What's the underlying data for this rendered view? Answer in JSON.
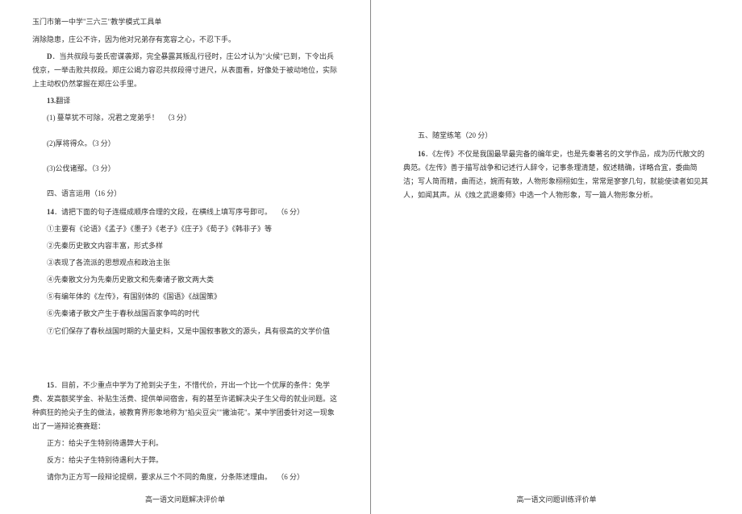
{
  "header": {
    "school_title": "玉门市第一中学\"三六三\"教学模式工具单"
  },
  "left": {
    "intro_line": "消除隐患，庄公不许，因为他对兄弟存有宽容之心，不忍下手。",
    "option_d_label": "D",
    "option_d_text": "．当共叔段与姜氏密谋袭郑，完全暴露其叛乱行径时，庄公才认为\"火候\"已到，下令出兵伐京，一举击败共叔段。郑庄公竭力容忍共叔段得寸进尺，从表面看，好像处于被动地位，实际上主动权仍然掌握在郑庄公手里。",
    "q13_num": "13.",
    "q13_title": "翻译",
    "q13_1": "(1) 蔓草犹不可除，况君之宠弟乎！",
    "q13_1_pts": "（3 分）",
    "q13_2": "(2)厚将得众。（3 分）",
    "q13_3": "(3)公伐诸鄢。（3 分）",
    "section4": "四、语言运用（16 分）",
    "q14_num": "14",
    "q14_text": "．请把下面的句子连缀成顺序合理的文段，在横线上填写序号即可。",
    "q14_pts": "（6 分）",
    "q14_opt1": "①主要有《论语》《孟子》《墨子》《老子》《庄子》《荀子》《韩非子》等",
    "q14_opt2": "②先秦历史散文内容丰富，形式多样",
    "q14_opt3": "③表现了各流派的思想观点和政治主张",
    "q14_opt4": "④先秦散文分为先秦历史散文和先秦诸子散文两大类",
    "q14_opt5": "⑤有编年体的《左传》，有国别体的《国语》《战国策》",
    "q14_opt6": "⑥先秦诸子散文产生于春秋战国百家争鸣的时代",
    "q14_opt7": "⑦它们保存了春秋战国时期的大量史料，又是中国叙事散文的源头，具有很高的文学价值",
    "q15_num": "15",
    "q15_text": "．目前，不少重点中学为了抢到尖子生，不惜代价，开出一个比一个优厚的条件：免学费、发高额奖学金、补贴生活费、提供单间宿舍，有的甚至许诺解决尖子生父母的就业问题。这种疯狂的抢尖子生的做法，被教育界形象地称为\"掐尖豆尖\"\"撇油花\"。某中学团委针对这一现象出了一道辩论赛赛题：",
    "q15_pro": "正方：给尖子生特别待遇弊大于利。",
    "q15_con": "反方：给尖子生特别待遇利大于弊。",
    "q15_task": "请你为正方写一段辩论提纲，要求从三个不同的角度，分条陈述理由。",
    "q15_pts": "（6 分）"
  },
  "right": {
    "section5": "五、随堂练笔（20 分）",
    "q16_num": "16",
    "q16_text": "．《左传》不仅是我国最早最完备的编年史，也是先秦著名的文学作品，成为历代散文的典范。《左传》善于描写战争和记述行人辞令，记事条理清楚，叙述精确，详略合宜，委曲简洁；写人简而精，曲而达，婉而有致，人物形象栩栩如生，常常是寥寥几句，就能使读者如见其人，如闻其声。从《烛之武退秦师》中选一个人物形象，写一篇人物形象分析。"
  },
  "footer": {
    "left": "高一语文问题解决评价单",
    "right": "高一语文问题训练评价单"
  }
}
